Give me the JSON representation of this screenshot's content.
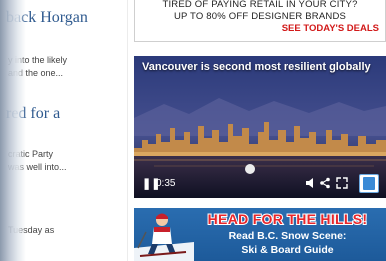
{
  "articles": [
    {
      "headline": "back Horgan",
      "lines": [
        "y into the likely",
        "and the one..."
      ]
    },
    {
      "headline": "red for a",
      "lines": [
        "cratic Party",
        "was well into..."
      ]
    },
    {
      "headline": "",
      "lines": [
        "Tuesday as"
      ]
    }
  ],
  "top_ad": {
    "line1": "TIRED OF PAYING RETAIL IN YOUR CITY?",
    "line2": "UP TO 80% OFF DESIGNER BRANDS",
    "cta": "SEE TODAY'S DEALS"
  },
  "video": {
    "title": "Vancouver is second most resilient globally",
    "time": "0:35",
    "progress": 0.46
  },
  "ski_ad": {
    "headline": "HEAD FOR THE HILLS!",
    "line1": "Read B.C. Snow Scene:",
    "line2": "Ski & Board Guide"
  },
  "colors": {
    "headline": "#2f5a8f",
    "cta_red": "#d21a1a",
    "ski_blue": "#2a6db0",
    "ski_red": "#e8262b"
  }
}
